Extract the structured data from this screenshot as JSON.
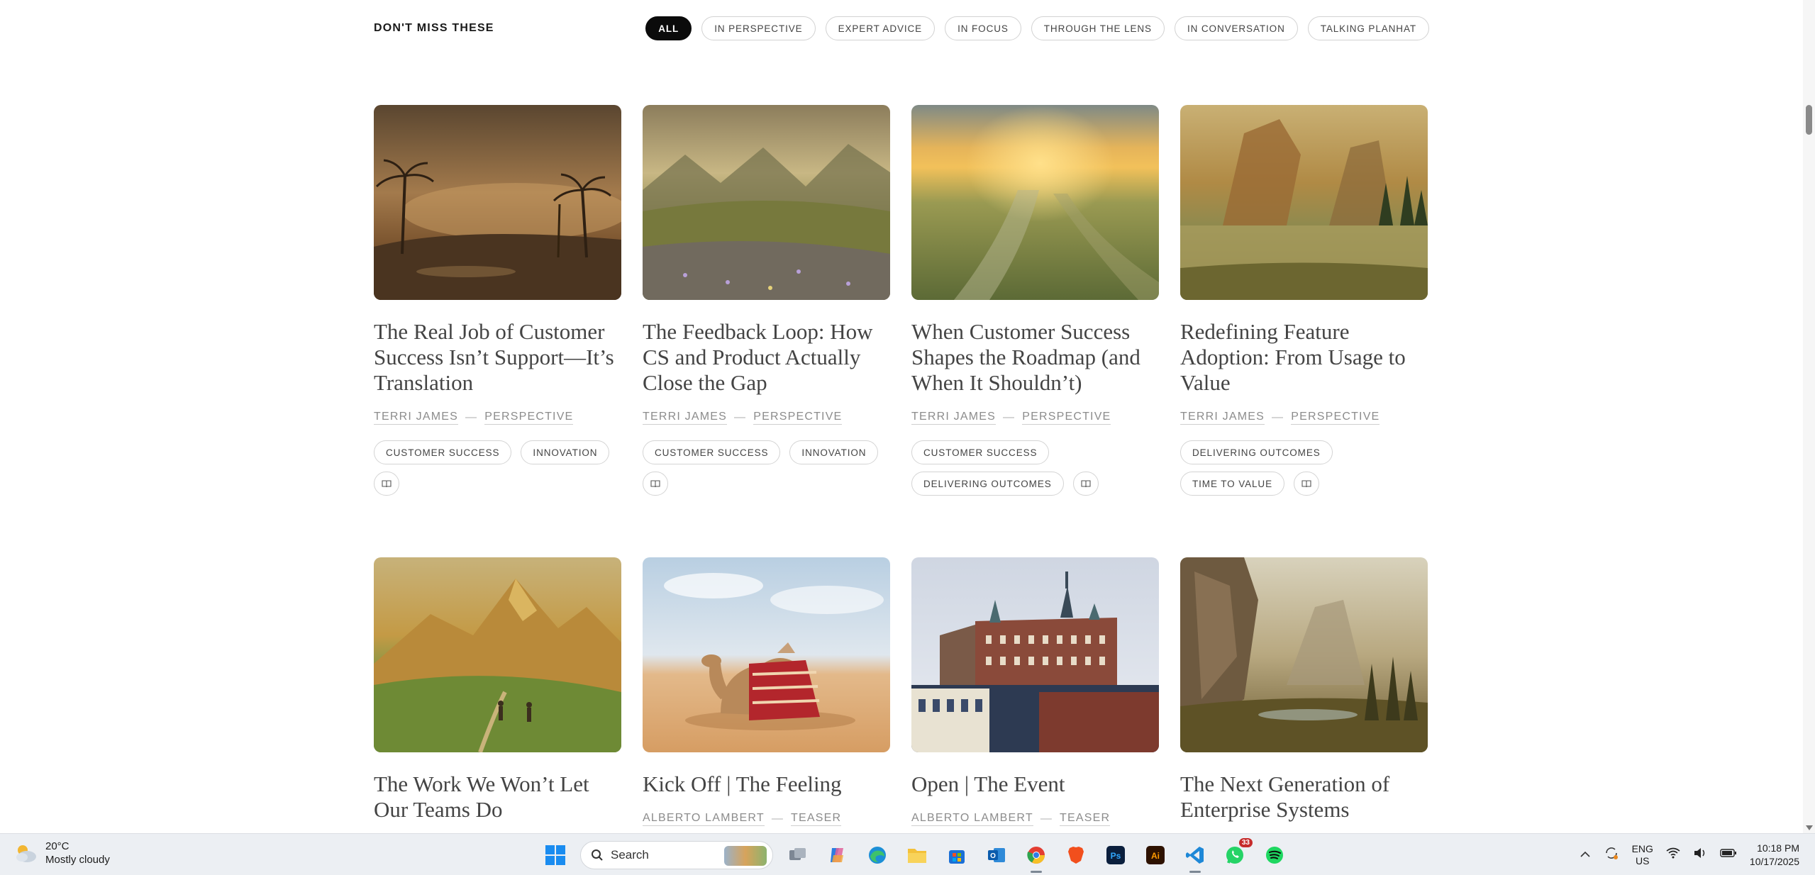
{
  "filter_bar": {
    "title": "DON'T MISS THESE",
    "pills": [
      {
        "label": "ALL",
        "active": true
      },
      {
        "label": "IN PERSPECTIVE",
        "active": false
      },
      {
        "label": "EXPERT ADVICE",
        "active": false
      },
      {
        "label": "IN FOCUS",
        "active": false
      },
      {
        "label": "THROUGH THE LENS",
        "active": false
      },
      {
        "label": "IN CONVERSATION",
        "active": false
      },
      {
        "label": "TALKING PLANHAT",
        "active": false
      }
    ]
  },
  "articles": [
    {
      "title": "The Real Job of Customer Success Isn’t Support—It’s Translation",
      "author": "TERRI JAMES",
      "category": "PERSPECTIVE",
      "tags": [
        "CUSTOMER SUCCESS",
        "INNOVATION"
      ],
      "icon": "book-icon"
    },
    {
      "title": "The Feedback Loop: How CS and Product Actually Close the Gap",
      "author": "TERRI JAMES",
      "category": "PERSPECTIVE",
      "tags": [
        "CUSTOMER SUCCESS",
        "INNOVATION"
      ],
      "icon": "book-icon"
    },
    {
      "title": "When Customer Success Shapes the Roadmap (and When It Shouldn’t)",
      "author": "TERRI JAMES",
      "category": "PERSPECTIVE",
      "tags": [
        "CUSTOMER SUCCESS",
        "DELIVERING OUTCOMES"
      ],
      "icon": "book-icon"
    },
    {
      "title": "Redefining Feature Adoption: From Usage to Value",
      "author": "TERRI JAMES",
      "category": "PERSPECTIVE",
      "tags": [
        "DELIVERING OUTCOMES",
        "TIME TO VALUE"
      ],
      "icon": "book-icon"
    },
    {
      "title": "The Work We Won’t Let Our Teams Do",
      "author": "",
      "category": "",
      "tags": [],
      "icon": ""
    },
    {
      "title": "Kick Off | The Feeling",
      "author": "ALBERTO LAMBERT",
      "category": "TEASER",
      "tags": [],
      "icon": ""
    },
    {
      "title": "Open | The Event",
      "author": "ALBERTO LAMBERT",
      "category": "TEASER",
      "tags": [],
      "icon": ""
    },
    {
      "title": "The Next Generation of Enterprise Systems",
      "author": "",
      "category": "",
      "tags": [],
      "icon": ""
    }
  ],
  "taskbar": {
    "weather_temp": "20°C",
    "weather_desc": "Mostly cloudy",
    "search_label": "Search",
    "whatsapp_badge": "33",
    "lang_top": "ENG",
    "lang_bottom": "US",
    "time": "10:18 PM",
    "date": "10/17/2025",
    "apps": [
      "windows-start-icon",
      "search",
      "task-view-icon",
      "copilot-icon",
      "edge-icon",
      "file-explorer-icon",
      "store-icon",
      "outlook-icon",
      "chrome-icon",
      "brave-icon",
      "photoshop-icon",
      "illustrator-icon",
      "vscode-icon",
      "whatsapp-icon",
      "spotify-icon"
    ]
  }
}
